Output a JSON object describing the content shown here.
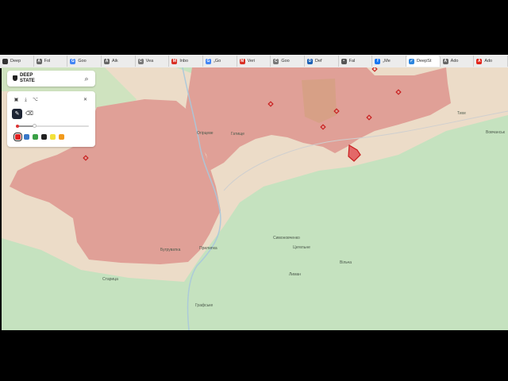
{
  "browser": {
    "tabs": [
      {
        "label": "Deep",
        "icon": "deepstate-favicon-icon",
        "color": "#333333",
        "glyph": ""
      },
      {
        "label": "Fol",
        "icon": "generic-a-favicon-icon",
        "color": "#666666",
        "glyph": "A"
      },
      {
        "label": "Goo",
        "icon": "google-favicon-icon",
        "color": "#4285f4",
        "glyph": "G"
      },
      {
        "label": "Aik",
        "icon": "generic-a-favicon-icon",
        "color": "#666666",
        "glyph": "A"
      },
      {
        "label": "Vea",
        "icon": "generic-c-favicon-icon",
        "color": "#777777",
        "glyph": "C"
      },
      {
        "label": "Inbo",
        "icon": "gmail-favicon-icon",
        "color": "#d93025",
        "glyph": "M"
      },
      {
        "label": "„Go",
        "icon": "google-favicon-icon",
        "color": "#4285f4",
        "glyph": "G"
      },
      {
        "label": "Veri",
        "icon": "gmail-favicon-icon",
        "color": "#d93025",
        "glyph": "M"
      },
      {
        "label": "Goo",
        "icon": "generic-c-favicon-icon",
        "color": "#777777",
        "glyph": "C"
      },
      {
        "label": "Def",
        "icon": "blue-d-favicon-icon",
        "color": "#1a5fb4",
        "glyph": "D"
      },
      {
        "label": "Fal",
        "icon": "globe-favicon-icon",
        "color": "#555555",
        "glyph": "•"
      },
      {
        "label": "„Me",
        "icon": "facebook-favicon-icon",
        "color": "#1877f2",
        "glyph": "f"
      },
      {
        "label": "DeepSt",
        "icon": "deepstate-favicon-icon",
        "color": "#2e86de",
        "glyph": "✓",
        "active": true
      },
      {
        "label": "Ado",
        "icon": "generic-a-favicon-icon",
        "color": "#666666",
        "glyph": "A"
      },
      {
        "label": "Ado",
        "icon": "adobe-favicon-icon",
        "color": "#e1251b",
        "glyph": "A"
      }
    ]
  },
  "brand": {
    "line1": "DEEP",
    "line2": "STATE"
  },
  "tools": {
    "layers_icon": "layers-icon",
    "download_icon": "download-icon",
    "share_icon": "share-icon",
    "close_icon": "close-icon",
    "draw_icon": "pen-icon",
    "erase_icon": "eraser-icon",
    "brush_size": 0.25,
    "colors": [
      "#e02020",
      "#3a78c8",
      "#3aa046",
      "#222222",
      "#f2e13a",
      "#f29a1c"
    ],
    "selected_color_index": 0
  },
  "map": {
    "occupied_color": "#e0a097",
    "contested_color": "#ecdcc8",
    "free_color": "#c5e2bf",
    "places": [
      {
        "name": "Огірцеве"
      },
      {
        "name": "Гатище"
      },
      {
        "name": "Старица"
      },
      {
        "name": "Бугруватка"
      },
      {
        "name": "Прилипка"
      },
      {
        "name": "Графське"
      },
      {
        "name": "Симоновченко"
      },
      {
        "name": "Цегельне"
      },
      {
        "name": "Лиман"
      },
      {
        "name": "Вільча"
      },
      {
        "name": "Вовчанськ"
      },
      {
        "name": "Тихе"
      }
    ]
  }
}
